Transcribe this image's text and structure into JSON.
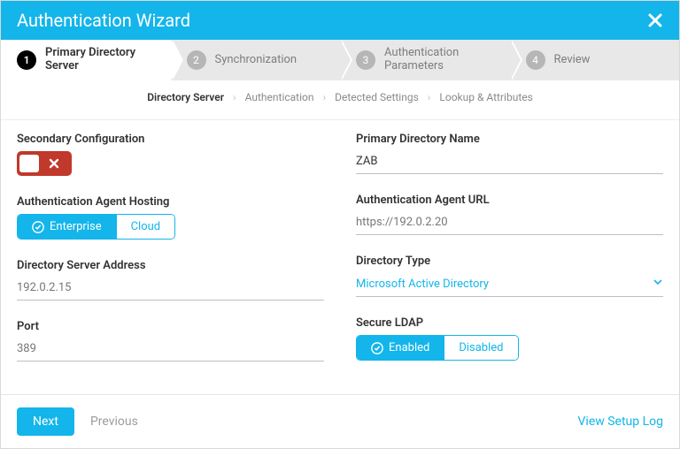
{
  "header": {
    "title": "Authentication Wizard",
    "close": "×"
  },
  "steps": [
    {
      "num": "1",
      "label": "Primary Directory Server"
    },
    {
      "num": "2",
      "label": "Synchronization"
    },
    {
      "num": "3",
      "label": "Authentication Parameters"
    },
    {
      "num": "4",
      "label": "Review"
    }
  ],
  "subtabs": {
    "t0": "Directory Server",
    "t1": "Authentication",
    "t2": "Detected Settings",
    "t3": "Lookup & Attributes"
  },
  "left": {
    "sec_conf_label": "Secondary Configuration",
    "hosting_label": "Authentication Agent Hosting",
    "hosting_opts": {
      "a": "Enterprise",
      "b": "Cloud"
    },
    "addr_label": "Directory Server Address",
    "addr_value": "192.0.2.15",
    "port_label": "Port",
    "port_value": "389"
  },
  "right": {
    "dirname_label": "Primary Directory Name",
    "dirname_value": "ZAB",
    "url_label": "Authentication Agent URL",
    "url_value": "https://192.0.2.20",
    "dtype_label": "Directory Type",
    "dtype_value": "Microsoft Active Directory",
    "sldap_label": "Secure LDAP",
    "sldap_opts": {
      "a": "Enabled",
      "b": "Disabled"
    }
  },
  "footer": {
    "next": "Next",
    "prev": "Previous",
    "log": "View Setup Log"
  }
}
